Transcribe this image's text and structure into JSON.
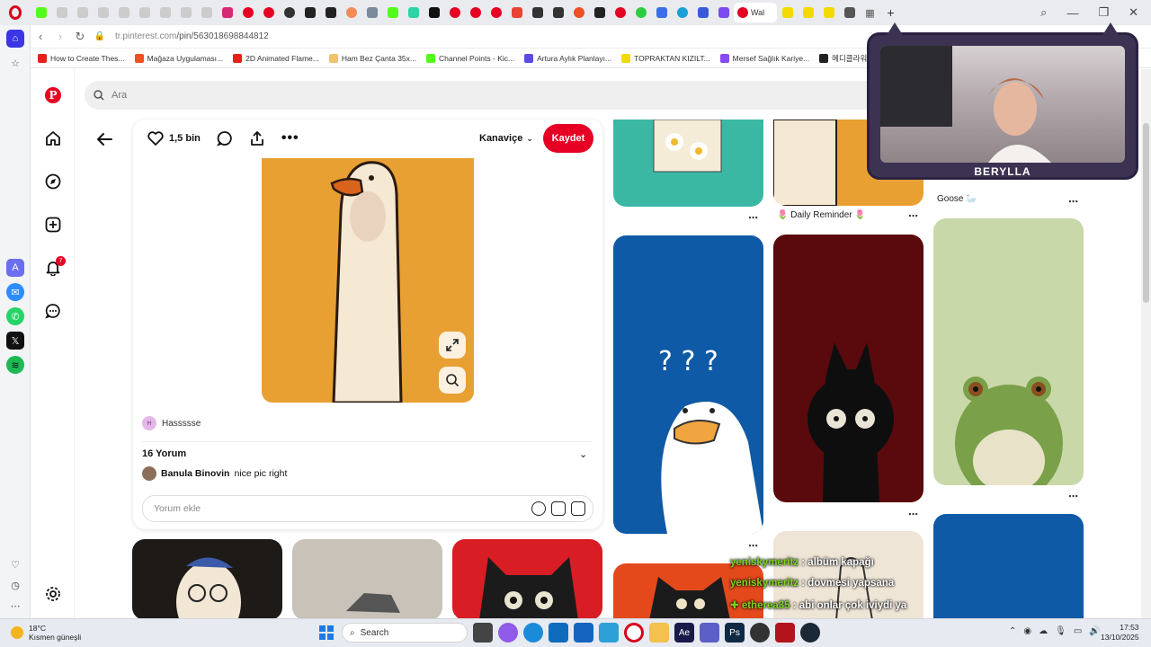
{
  "browser": {
    "active_tab_label": "Wal",
    "url_host": "tr.pinterest.com",
    "url_path": "/pin/563018698844812",
    "bookmarks": [
      {
        "label": "How to Create Thes...",
        "color": "#e62117"
      },
      {
        "label": "Mağaza Uygulaması...",
        "color": "#f25022"
      },
      {
        "label": "2D Animated Flame...",
        "color": "#e62117"
      },
      {
        "label": "Ham Bez Çanta 35x...",
        "color": "#f0c36d"
      },
      {
        "label": "Channel Points - Kic...",
        "color": "#53fc18"
      },
      {
        "label": "Artura Aylık Planlayı...",
        "color": "#5b4cdb"
      },
      {
        "label": "TOPRAKTAN KIZILT...",
        "color": "#f2da00"
      },
      {
        "label": "Mersef Sağlık Kariye...",
        "color": "#8a4af3"
      },
      {
        "label": "메디클라워",
        "color": "#222222"
      }
    ]
  },
  "pinterest": {
    "search_placeholder": "Ara",
    "bell_badge": "7",
    "like_count": "1,5 bin",
    "board_name": "Kanaviçe",
    "save_label": "Kaydet",
    "author_initial": "H",
    "author_name": "Hassssse",
    "comments_title": "16 Yorum",
    "comment_author": "Banula Binovin",
    "comment_text": "nice pic right",
    "comment_placeholder": "Yorum ekle",
    "captions": {
      "daily_reminder": "🌷 Daily Reminder 🌷",
      "goose": "Goose 🦢"
    }
  },
  "stream": {
    "streamer_name": "BERYLLA",
    "chat": [
      {
        "nick": "yeniskymeritz",
        "msg": ": albüm kapağı"
      },
      {
        "nick": "yeniskymeritz",
        "msg": ": dovmesi yapsana"
      },
      {
        "nick": "✚ etherea35",
        "msg": ": abi onlar çok iviydi ya"
      }
    ]
  },
  "taskbar": {
    "temp": "18°C",
    "weather_text": "Kısmen güneşli",
    "search_label": "Search",
    "time": "17:53",
    "date": "13/10/2025"
  },
  "colors": {
    "pinterest_red": "#e60023",
    "goose_orange": "#e8a033",
    "tile_blue": "#0f5aa6",
    "tile_maroon": "#5a0a0c",
    "tile_green": "#c9d8a9",
    "chat_nick": "#7dd321"
  }
}
